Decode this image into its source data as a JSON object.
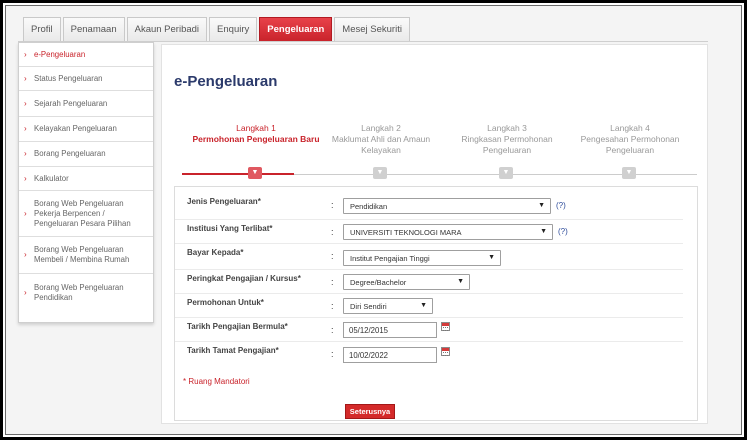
{
  "tabs": [
    "Profil",
    "Penamaan",
    "Akaun Peribadi",
    "Enquiry",
    "Pengeluaran",
    "Mesej Sekuriti"
  ],
  "active_tab": "Pengeluaran",
  "sidebar": {
    "items": [
      {
        "label": "e-Pengeluaran",
        "active": true
      },
      {
        "label": "Status Pengeluaran",
        "active": false
      },
      {
        "label": "Sejarah Pengeluaran",
        "active": false
      },
      {
        "label": "Kelayakan Pengeluaran",
        "active": false
      },
      {
        "label": "Borang Pengeluaran",
        "active": false
      },
      {
        "label": "Kalkulator",
        "active": false
      },
      {
        "label": "Borang Web Pengeluaran Pekerja Berpencen / Pengeluaran Pesara Pilihan",
        "active": false
      },
      {
        "label": "Borang Web Pengeluaran Membeli / Membina Rumah",
        "active": false
      },
      {
        "label": "Borang Web Pengeluaran Pendidikan",
        "active": false
      }
    ]
  },
  "page_title": "e-Pengeluaran",
  "steps": [
    {
      "title": "Langkah 1",
      "desc": "Permohonan Pengeluaran Baru",
      "active": true
    },
    {
      "title": "Langkah 2",
      "desc": "Maklumat Ahli dan Amaun Kelayakan",
      "active": false
    },
    {
      "title": "Langkah 3",
      "desc": "Ringkasan Permohonan Pengeluaran",
      "active": false
    },
    {
      "title": "Langkah 4",
      "desc": "Pengesahan Permohonan Pengeluaran",
      "active": false
    }
  ],
  "form": {
    "jenis_label": "Jenis Pengeluaran*",
    "jenis_value": "Pendidikan",
    "help_text": "(?)",
    "institusi_label": "Institusi Yang Terlibat*",
    "institusi_value": "UNIVERSITI TEKNOLOGI MARA",
    "bayar_label": "Bayar Kepada*",
    "bayar_value": "Institut Pengajian Tinggi",
    "peringkat_label": "Peringkat Pengajian / Kursus*",
    "peringkat_value": "Degree/Bachelor",
    "permohonan_label": "Permohonan Untuk*",
    "permohonan_value": "Diri Sendiri",
    "mula_label": "Tarikh Pengajian Bermula*",
    "mula_value": "05/12/2015",
    "tamat_label": "Tarikh Tamat Pengajian*",
    "tamat_value": "10/02/2022",
    "colon": ":",
    "mandatory_note": "* Ruang Mandatori",
    "submit_label": "Seterusnya"
  },
  "icons": {
    "chevron": "chevron-down-icon",
    "calendar": "calendar-icon",
    "arrow": "arrow-right-icon"
  },
  "colors": {
    "accent": "#c9232b",
    "title": "#2b3a6b"
  }
}
